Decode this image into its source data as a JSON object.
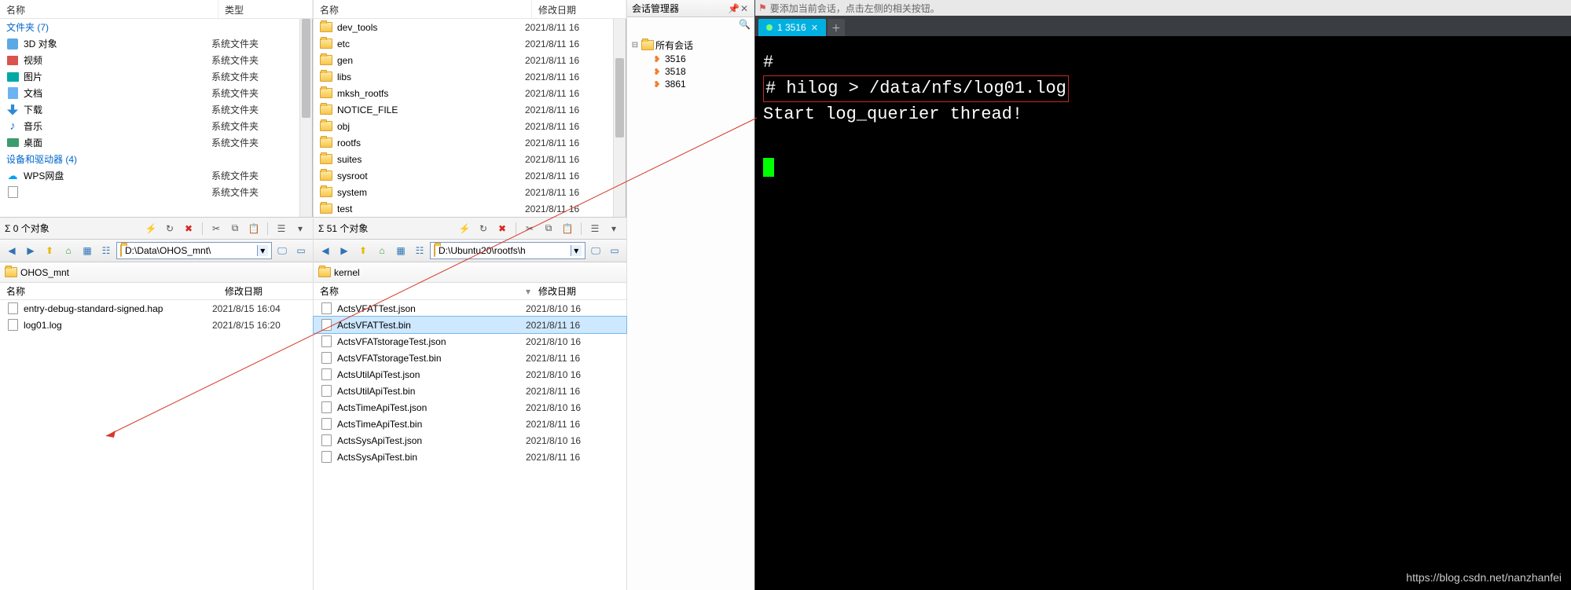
{
  "fm_left": {
    "header": {
      "name": "名称",
      "type": "类型"
    },
    "group_folders": "文件夹 (7)",
    "folders": [
      {
        "label": "3D 对象",
        "type": "系统文件夹",
        "icon": "3d"
      },
      {
        "label": "视频",
        "type": "系统文件夹",
        "icon": "vid"
      },
      {
        "label": "图片",
        "type": "系统文件夹",
        "icon": "img"
      },
      {
        "label": "文档",
        "type": "系统文件夹",
        "icon": "doc"
      },
      {
        "label": "下载",
        "type": "系统文件夹",
        "icon": "dl"
      },
      {
        "label": "音乐",
        "type": "系统文件夹",
        "icon": "mus"
      },
      {
        "label": "桌面",
        "type": "系统文件夹",
        "icon": "desk"
      }
    ],
    "group_drives": "设备和驱动器 (4)",
    "drives": [
      {
        "label": "WPS网盘",
        "type": "系统文件夹",
        "icon": "wps"
      },
      {
        "label": "",
        "type": "系统文件夹",
        "icon": "file"
      }
    ],
    "status": "Σ 0 个对象",
    "path": "D:\\Data\\OHOS_mnt\\",
    "crumb": "OHOS_mnt",
    "header2": {
      "name": "名称",
      "date": "修改日期"
    },
    "files": [
      {
        "name": "entry-debug-standard-signed.hap",
        "date": "2021/8/15 16:04"
      },
      {
        "name": "log01.log",
        "date": "2021/8/15 16:20"
      }
    ]
  },
  "fm_right": {
    "header": {
      "name": "名称",
      "date": "修改日期"
    },
    "folders": [
      {
        "name": "dev_tools",
        "date": "2021/8/11 16"
      },
      {
        "name": "etc",
        "date": "2021/8/11 16"
      },
      {
        "name": "gen",
        "date": "2021/8/11 16"
      },
      {
        "name": "libs",
        "date": "2021/8/11 16"
      },
      {
        "name": "mksh_rootfs",
        "date": "2021/8/11 16"
      },
      {
        "name": "NOTICE_FILE",
        "date": "2021/8/11 16"
      },
      {
        "name": "obj",
        "date": "2021/8/11 16"
      },
      {
        "name": "rootfs",
        "date": "2021/8/11 16"
      },
      {
        "name": "suites",
        "date": "2021/8/11 16"
      },
      {
        "name": "sysroot",
        "date": "2021/8/11 16"
      },
      {
        "name": "system",
        "date": "2021/8/11 16"
      },
      {
        "name": "test",
        "date": "2021/8/11 16"
      }
    ],
    "status": "Σ 51 个对象",
    "path": "D:\\Ubuntu20\\rootfs\\h",
    "crumb": "kernel",
    "header2": {
      "name": "名称",
      "date": "修改日期"
    },
    "files": [
      {
        "name": "ActsVFATTest.json",
        "date": "2021/8/10 16"
      },
      {
        "name": "ActsVFATTest.bin",
        "date": "2021/8/11 16",
        "selected": true
      },
      {
        "name": "ActsVFATstorageTest.json",
        "date": "2021/8/10 16"
      },
      {
        "name": "ActsVFATstorageTest.bin",
        "date": "2021/8/11 16"
      },
      {
        "name": "ActsUtilApiTest.json",
        "date": "2021/8/10 16"
      },
      {
        "name": "ActsUtilApiTest.bin",
        "date": "2021/8/11 16"
      },
      {
        "name": "ActsTimeApiTest.json",
        "date": "2021/8/10 16"
      },
      {
        "name": "ActsTimeApiTest.bin",
        "date": "2021/8/11 16"
      },
      {
        "name": "ActsSysApiTest.json",
        "date": "2021/8/10 16"
      },
      {
        "name": "ActsSysApiTest.bin",
        "date": "2021/8/11 16"
      }
    ]
  },
  "session": {
    "title": "会话管理器",
    "root": "所有会话",
    "items": [
      "3516",
      "3518",
      "3861"
    ]
  },
  "terminal": {
    "top_hint": "要添加当前会话，点击左侧的相关按钮。",
    "tab_label": "1 3516",
    "lines": [
      "# ",
      "# hilog > /data/nfs/log01.log",
      "Start log_querier thread!"
    ]
  },
  "watermark": "https://blog.csdn.net/nanzhanfei"
}
